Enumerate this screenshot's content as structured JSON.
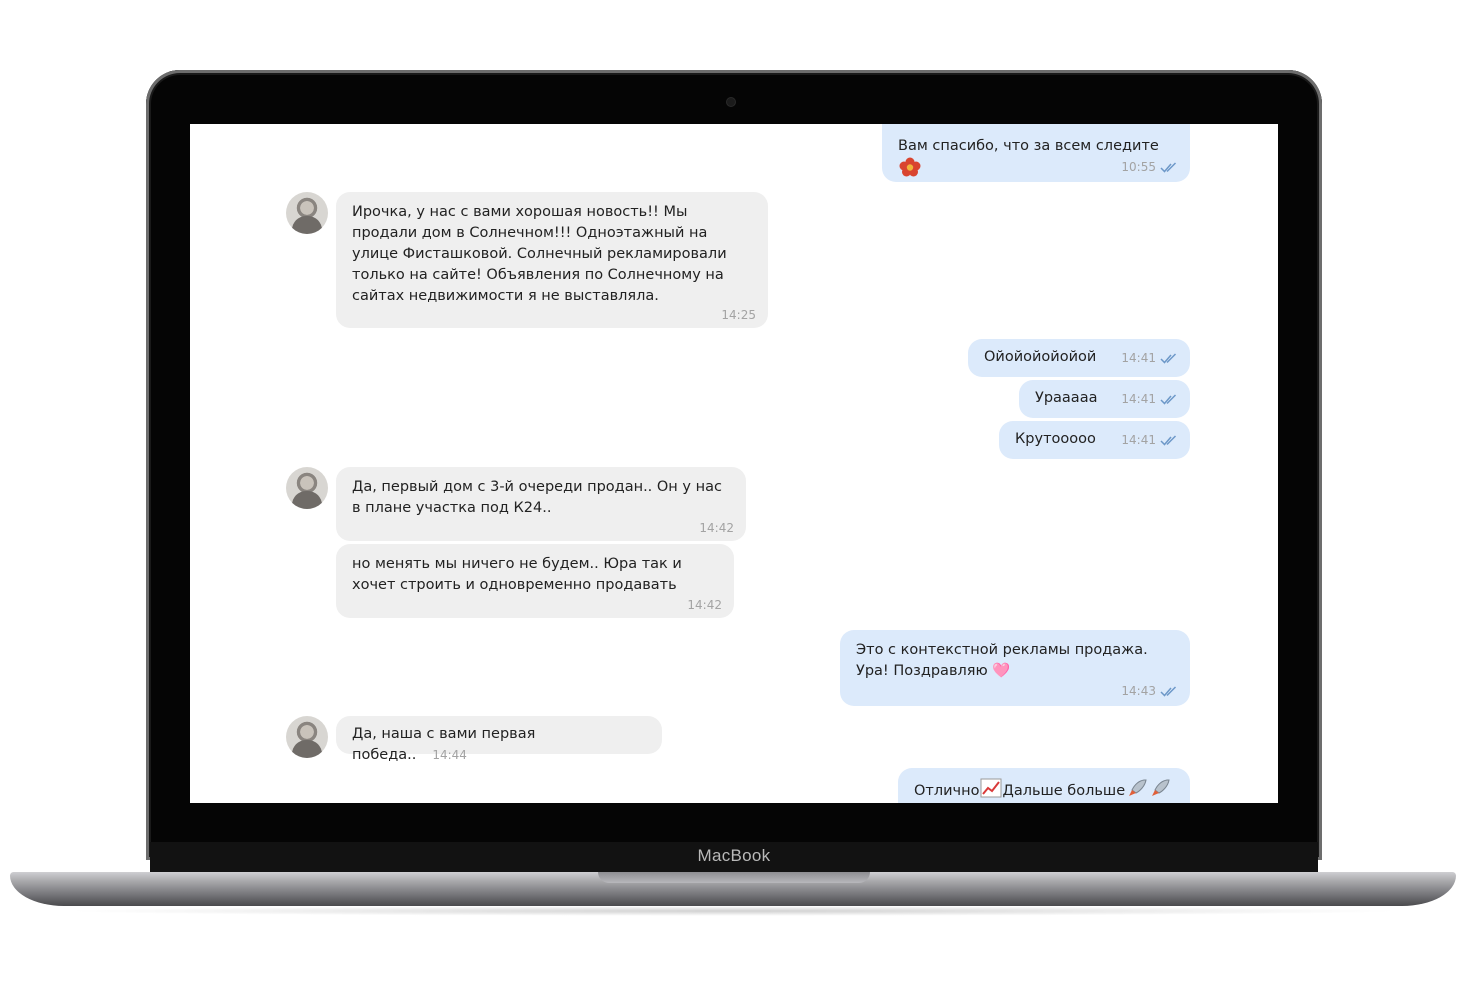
{
  "device": {
    "brand": "MacBook"
  },
  "chat": {
    "messages": [
      {
        "side": "out",
        "text": "Вам спасибо, что за всем следите",
        "emoji": "flower",
        "time": "10:55"
      },
      {
        "side": "in",
        "text": "Ирочка, у нас с вами хорошая новость!! Мы продали дом в Солнечном!!! Одноэтажный на улице Фисташковой. Солнечный рекламировали только на сайте! Объявления по Солнечному на сайтах недвижимости я не выставляла.",
        "time": "14:25"
      },
      {
        "side": "out",
        "text": "Ойойойойойой",
        "time": "14:41"
      },
      {
        "side": "out",
        "text": "Ураaaaa",
        "time": "14:41"
      },
      {
        "side": "out",
        "text": "Крутооооо",
        "time": "14:41"
      },
      {
        "side": "in",
        "text": "Да, первый дом с 3-й очереди продан.. Он у нас в плане участка под К24..",
        "time": "14:42"
      },
      {
        "side": "in",
        "text": "но менять мы ничего не будем.. Юра так и хочет строить и одновременно продавать",
        "time": "14:42"
      },
      {
        "side": "out",
        "text": "Это с контекстной рекламы продажа. Ура! Поздравляю 🩷",
        "time": "14:43"
      },
      {
        "side": "in",
        "text": "Да, наша с вами первая победа..",
        "time": "14:44"
      },
      {
        "side": "out",
        "text_a": "Отлично",
        "emoji_a": "chart-increasing",
        "text_b": "Дальше больше",
        "emoji_b": "rocket"
      }
    ]
  },
  "colors": {
    "incoming_bubble": "#efefef",
    "outgoing_bubble": "#dceafb",
    "read_check": "#6d98c8",
    "timestamp": "#a3a3a3"
  }
}
